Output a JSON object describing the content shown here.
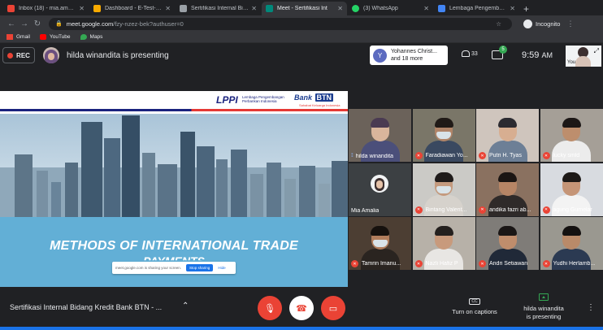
{
  "browser": {
    "tabs": [
      {
        "label": "Inbox (18) - mia.amalia@",
        "favicon_color": "#ea4335",
        "active": false
      },
      {
        "label": "Dashboard - E-Test-LPPI",
        "favicon_color": "#f9ab00",
        "active": false
      },
      {
        "label": "Sertifikasi Internal Bidang",
        "favicon_color": "#9aa0a6",
        "active": false
      },
      {
        "label": "Meet - Sertifikasi Int",
        "favicon_color": "#00897b",
        "active": true
      },
      {
        "label": "(3) WhatsApp",
        "favicon_color": "#25d366",
        "active": false
      },
      {
        "label": "Lembaga Pengembangan",
        "favicon_color": "#4285f4",
        "active": false
      }
    ],
    "url_host": "meet.google.com",
    "url_path": "/fzy-nzez-bek?authuser=0",
    "incognito_label": "Incognito",
    "bookmarks": [
      {
        "label": "Gmail",
        "color": "#ea4335"
      },
      {
        "label": "YouTube",
        "color": "#ff0000"
      },
      {
        "label": "Maps",
        "color": "#34a853"
      }
    ]
  },
  "meet": {
    "rec_label": "REC",
    "presenting_text": "hilda winandita is presenting",
    "join_popup": {
      "initial": "Y",
      "line1": "Yohannes Christ...",
      "line2": "and 18 more"
    },
    "people_count": "33",
    "chat_badge": "5",
    "clock": "9:59",
    "clock_period": "AM",
    "self_label": "You",
    "meeting_title": "Sertifikasi Internal Bidang Kredit Bank BTN - ...",
    "captions_label": "Turn on captions",
    "captions_icon": "CC",
    "presenting_status": "hilda winandita is presenting",
    "presenting_line1": "hilda winandita",
    "presenting_line2": "is presenting"
  },
  "slide": {
    "lppi_logo": "LPPI",
    "lppi_sub_line1": "Lembaga Pengembangan",
    "lppi_sub_line2": "Perbankan Indonesia",
    "btn_logo_text": "Bank",
    "btn_logo_box": "BTN",
    "btn_slogan": "Sahabat Keluarga Indonesia",
    "title_line1": "METHODS OF INTERNATIONAL TRADE",
    "title_line2": "PAYMENTS",
    "share_text": "meet.google.com is sharing your screen.",
    "share_stop": "Stop sharing",
    "share_hide": "Hide"
  },
  "participants": [
    {
      "name": "hilda winandita",
      "muted": false,
      "speaking": true,
      "bg": "#6b625a",
      "skin": "#d9b59c",
      "hair": "#4a3a52",
      "shirt": "#4b4f7a",
      "mask": false,
      "avatar": false
    },
    {
      "name": "Faradiawan Yo...",
      "muted": true,
      "speaking": false,
      "bg": "#7a7668",
      "skin": "#b08468",
      "hair": "#201a17",
      "shirt": "#3a4960",
      "mask": true,
      "avatar": false
    },
    {
      "name": "Putri H. Tyas",
      "muted": true,
      "speaking": false,
      "bg": "#cfc5bd",
      "skin": "#d7ae91",
      "hair": "#2c2b31",
      "shirt": "#6d7f96",
      "mask": false,
      "avatar": false
    },
    {
      "name": "lucky smld",
      "muted": true,
      "speaking": false,
      "bg": "#a59f97",
      "skin": "#bd8e6d",
      "hair": "#1c1716",
      "shirt": "#ececec",
      "mask": false,
      "avatar": false
    },
    {
      "name": "Mia Amalia",
      "muted": false,
      "speaking": false,
      "bg": "#3c4043",
      "skin": "#e5c2a8",
      "hair": "#3c2f2f",
      "shirt": "#3c4043",
      "mask": false,
      "avatar": true
    },
    {
      "name": "Bintang Valent...",
      "muted": true,
      "speaking": false,
      "bg": "#cbcac6",
      "skin": "#c49a7e",
      "hair": "#1f1b1a",
      "shirt": "#d6d2cc",
      "mask": true,
      "avatar": false
    },
    {
      "name": "andika fazri ab...",
      "muted": true,
      "speaking": false,
      "bg": "#8a7160",
      "skin": "#b78565",
      "hair": "#1b1513",
      "shirt": "#2f2a29",
      "mask": false,
      "avatar": false
    },
    {
      "name": "agung Gumelar",
      "muted": true,
      "speaking": false,
      "bg": "#d8dbe0",
      "skin": "#c59577",
      "hair": "#1d1917",
      "shirt": "#f3f3f3",
      "mask": false,
      "avatar": false
    },
    {
      "name": "Tamrin Imanu...",
      "muted": true,
      "speaking": false,
      "bg": "#4c3e33",
      "skin": "#b17d5c",
      "hair": "#16110e",
      "shirt": "#2a2420",
      "mask": true,
      "avatar": false
    },
    {
      "name": "Nazli Hafiz P",
      "muted": true,
      "speaking": false,
      "bg": "#b7b1a8",
      "skin": "#c89a7c",
      "hair": "#24201e",
      "shirt": "#e8e6e3",
      "mask": false,
      "avatar": false
    },
    {
      "name": "Andri Setiawan",
      "muted": true,
      "speaking": false,
      "bg": "#7f7c78",
      "skin": "#bf8d6c",
      "hair": "#1a1615",
      "shirt": "#202938",
      "mask": false,
      "avatar": false
    },
    {
      "name": "Yudhi Herlamb...",
      "muted": true,
      "speaking": false,
      "bg": "#9a9890",
      "skin": "#b98a69",
      "hair": "#141110",
      "shirt": "#2b3a52",
      "mask": false,
      "avatar": false
    }
  ],
  "colors": {
    "accent": "#1a73e8",
    "danger": "#ea4335",
    "success": "#34a853",
    "surface": "#202124"
  }
}
